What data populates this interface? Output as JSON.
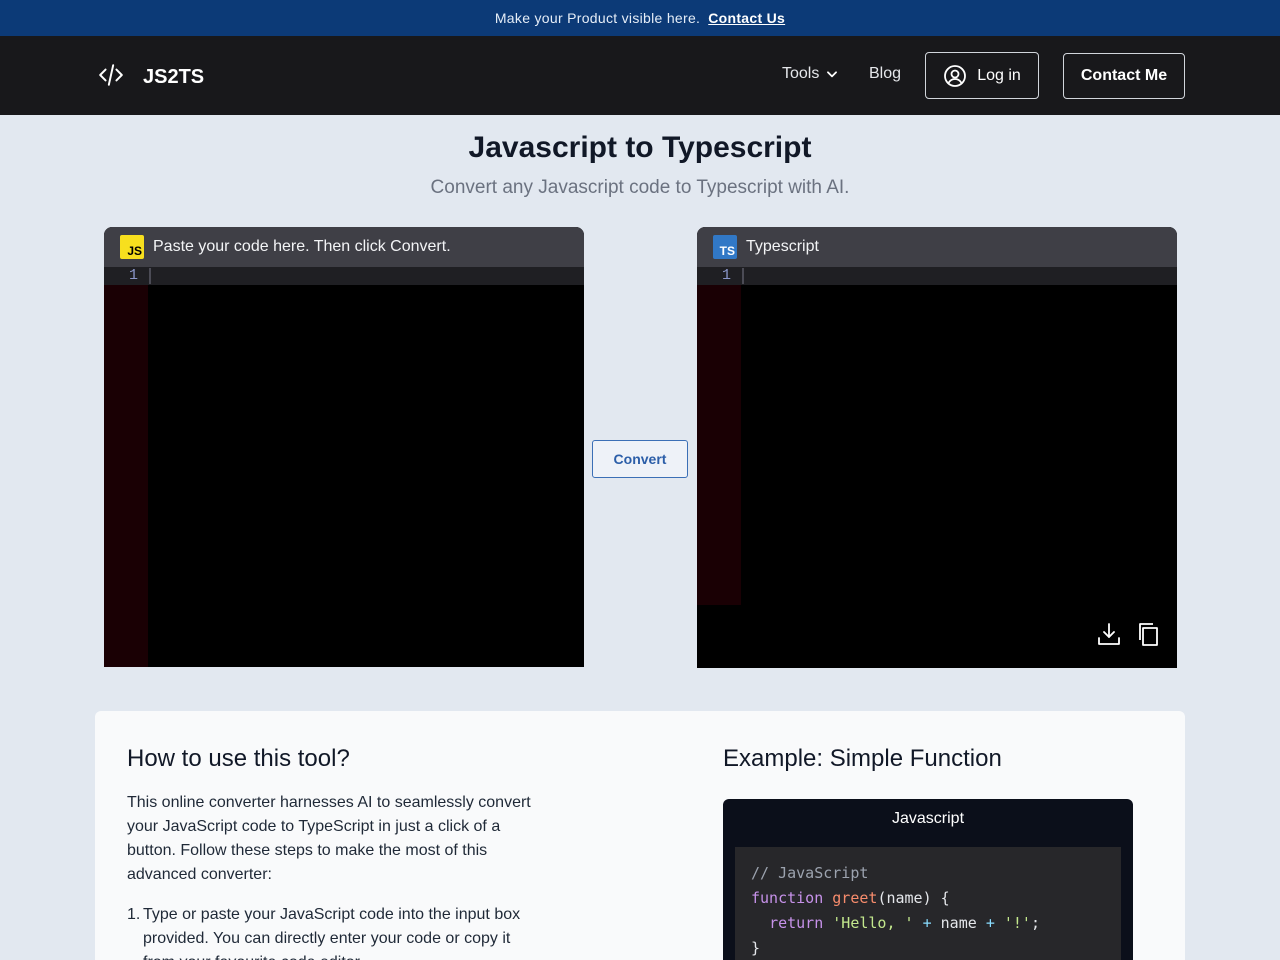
{
  "promo": {
    "text": "Make your Product visible here.",
    "link": "Contact Us"
  },
  "nav": {
    "brand": "JS2TS",
    "tools": "Tools",
    "blog": "Blog",
    "login": "Log in",
    "contact": "Contact Me"
  },
  "hero": {
    "title": "Javascript to Typescript",
    "subtitle": "Convert any Javascript code to Typescript with AI."
  },
  "input_editor": {
    "badge": "JS",
    "header": "Paste your code here. Then click Convert.",
    "line_number": "1"
  },
  "output_editor": {
    "badge": "TS",
    "header": "Typescript",
    "line_number": "1"
  },
  "convert_button": "Convert",
  "how_to": {
    "title": "How to use this tool?",
    "intro": "This online converter harnesses AI to seamlessly convert your JavaScript code to TypeScript in just a click of a button. Follow these steps to make the most of this advanced converter:",
    "steps": [
      {
        "num": "1.",
        "text": "Type or paste your JavaScript code into the input box provided. You can directly enter your code or copy it from your favourite code editor."
      }
    ]
  },
  "example": {
    "title": "Example: Simple Function",
    "tab": "Javascript",
    "code": {
      "comment": "// JavaScript",
      "kw_function": "function",
      "fn_name": "greet",
      "params": "(name)",
      "open_brace": "{",
      "kw_return": "return",
      "str_hello": "'Hello, '",
      "plus": "+",
      "var_name": "name",
      "str_bang": "'!'",
      "semicolon": ";",
      "close_brace": "}"
    }
  },
  "colors": {
    "promo_bg": "#0c3a77",
    "nav_bg": "#18181b",
    "page_bg": "#e2e8f0",
    "js_badge": "#f7df1e",
    "ts_badge": "#3178c6",
    "convert_border": "#3b6fb6"
  },
  "icons": {
    "brand": "code-icon",
    "tools": "chevron-down-icon",
    "login": "user-circle-icon",
    "download": "download-icon",
    "copy": "copy-icon"
  }
}
